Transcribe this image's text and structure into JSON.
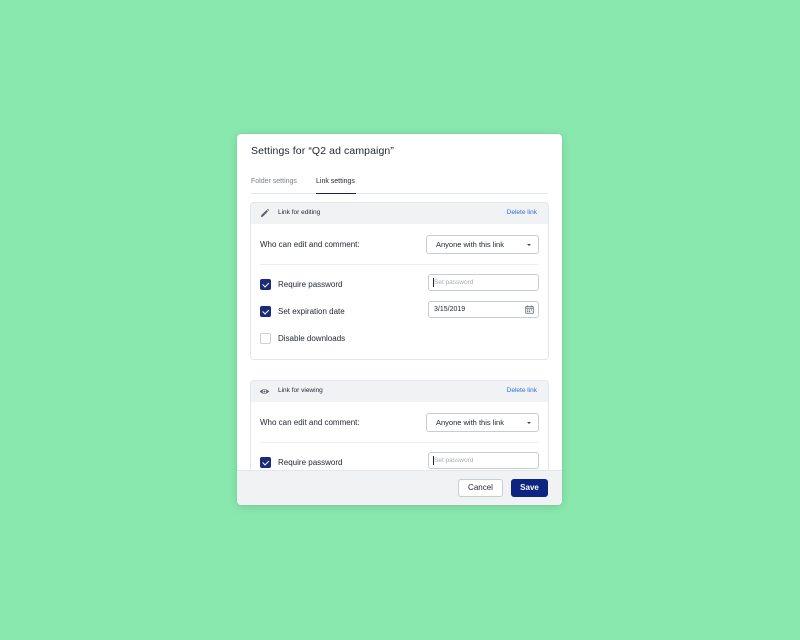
{
  "dialog": {
    "title": "Settings for “Q2 ad campaign”",
    "tabs": [
      {
        "label": "Folder settings",
        "active": false
      },
      {
        "label": "Link settings",
        "active": true
      }
    ],
    "cancel_label": "Cancel",
    "save_label": "Save"
  },
  "links": [
    {
      "icon": "pencil-icon",
      "title": "Link for editing",
      "delete_label": "Delete link",
      "who_label": "Who can edit and comment:",
      "who_value": "Anyone with this link",
      "require_password": {
        "label": "Require password",
        "checked": true,
        "placeholder": "Set password"
      },
      "expiration": {
        "label": "Set expiration date",
        "checked": true,
        "value": "3/15/2019"
      },
      "disable_downloads": {
        "label": "Disable downloads",
        "checked": false
      }
    },
    {
      "icon": "eye-icon",
      "title": "Link for viewing",
      "delete_label": "Delete link",
      "who_label": "Who can edit and comment:",
      "who_value": "Anyone with this link",
      "require_password": {
        "label": "Require password",
        "checked": true,
        "placeholder": "Set password"
      }
    }
  ],
  "colors": {
    "background": "#89e8ae",
    "primary": "#0d2480",
    "checkbox": "#1c2a7a",
    "link": "#2f6fd8"
  }
}
